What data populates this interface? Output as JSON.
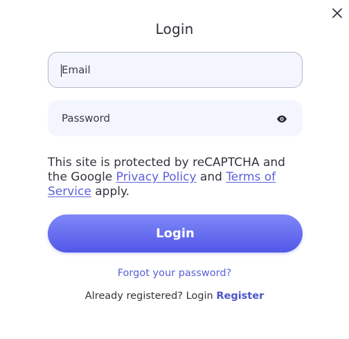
{
  "dialog": {
    "title": "Login",
    "close_icon": "close-icon"
  },
  "form": {
    "email_placeholder": "Email",
    "email_value": "",
    "password_placeholder": "Password",
    "password_value": "",
    "password_toggle_icon": "eye-icon",
    "notice": {
      "prefix": "This site is protected by reCAPTCHA and the Google ",
      "privacy_link": "Privacy Policy",
      "middle": " and ",
      "terms_link": "Terms of Service",
      "suffix": " apply."
    },
    "login_button": "Login",
    "forgot_link": "Forgot your password?",
    "register_prefix": "Already registered? Login ",
    "register_link": "Register"
  },
  "colors": {
    "accent": "#5a5fd8",
    "button_gradient_top": "#7e88f7",
    "button_gradient_bottom": "#5257e8",
    "field_background": "#f3f6ff"
  }
}
